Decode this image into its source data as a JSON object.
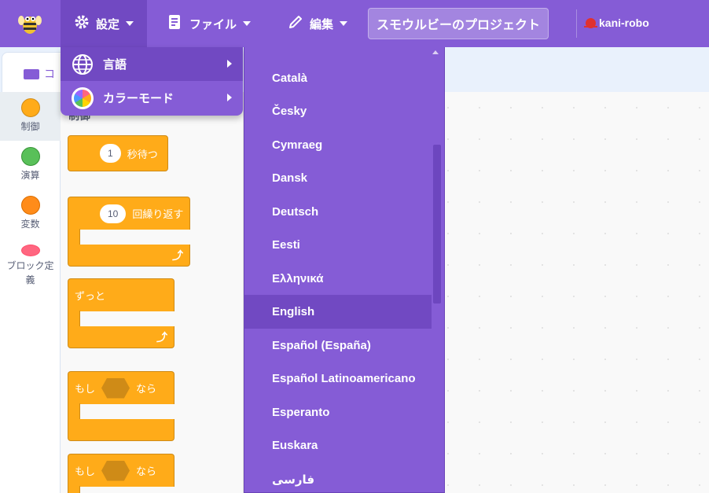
{
  "header": {
    "settings_label": "設定",
    "file_label": "ファイル",
    "edit_label": "編集",
    "project_title": "スモウルビーのプロジェクト",
    "username": "kani-robo"
  },
  "settings_menu": {
    "items": [
      {
        "label": "言語",
        "icon": "globe-icon"
      },
      {
        "label": "カラーモード",
        "icon": "color-mode-icon"
      }
    ]
  },
  "workspace": {
    "tab_code_label": "コ"
  },
  "categories": [
    {
      "label": "制御",
      "color": "#ffab19"
    },
    {
      "label": "演算",
      "color": "#59c059"
    },
    {
      "label": "変数",
      "color": "#ff8c1a"
    },
    {
      "label": "ブロック定義",
      "color": "#ff6680"
    }
  ],
  "palette": {
    "heading": "制御",
    "wait": {
      "value": "1",
      "text": "秒待つ"
    },
    "repeat": {
      "value": "10",
      "text": "回繰り返す"
    },
    "forever": "ずっと",
    "if1": {
      "pre": "もし",
      "post": "なら"
    },
    "if2": {
      "pre": "もし",
      "post": "なら"
    }
  },
  "language_menu": {
    "selected": "English",
    "items": [
      "Català",
      "Česky",
      "Cymraeg",
      "Dansk",
      "Deutsch",
      "Eesti",
      "Ελληνικά",
      "English",
      "Español (España)",
      "Español Latinoamericano",
      "Esperanto",
      "Euskara",
      "فارسی"
    ]
  },
  "colors": {
    "menu_bar": "#855cd6",
    "menu_highlight": "#7149c2",
    "control_block": "#ffab19"
  }
}
